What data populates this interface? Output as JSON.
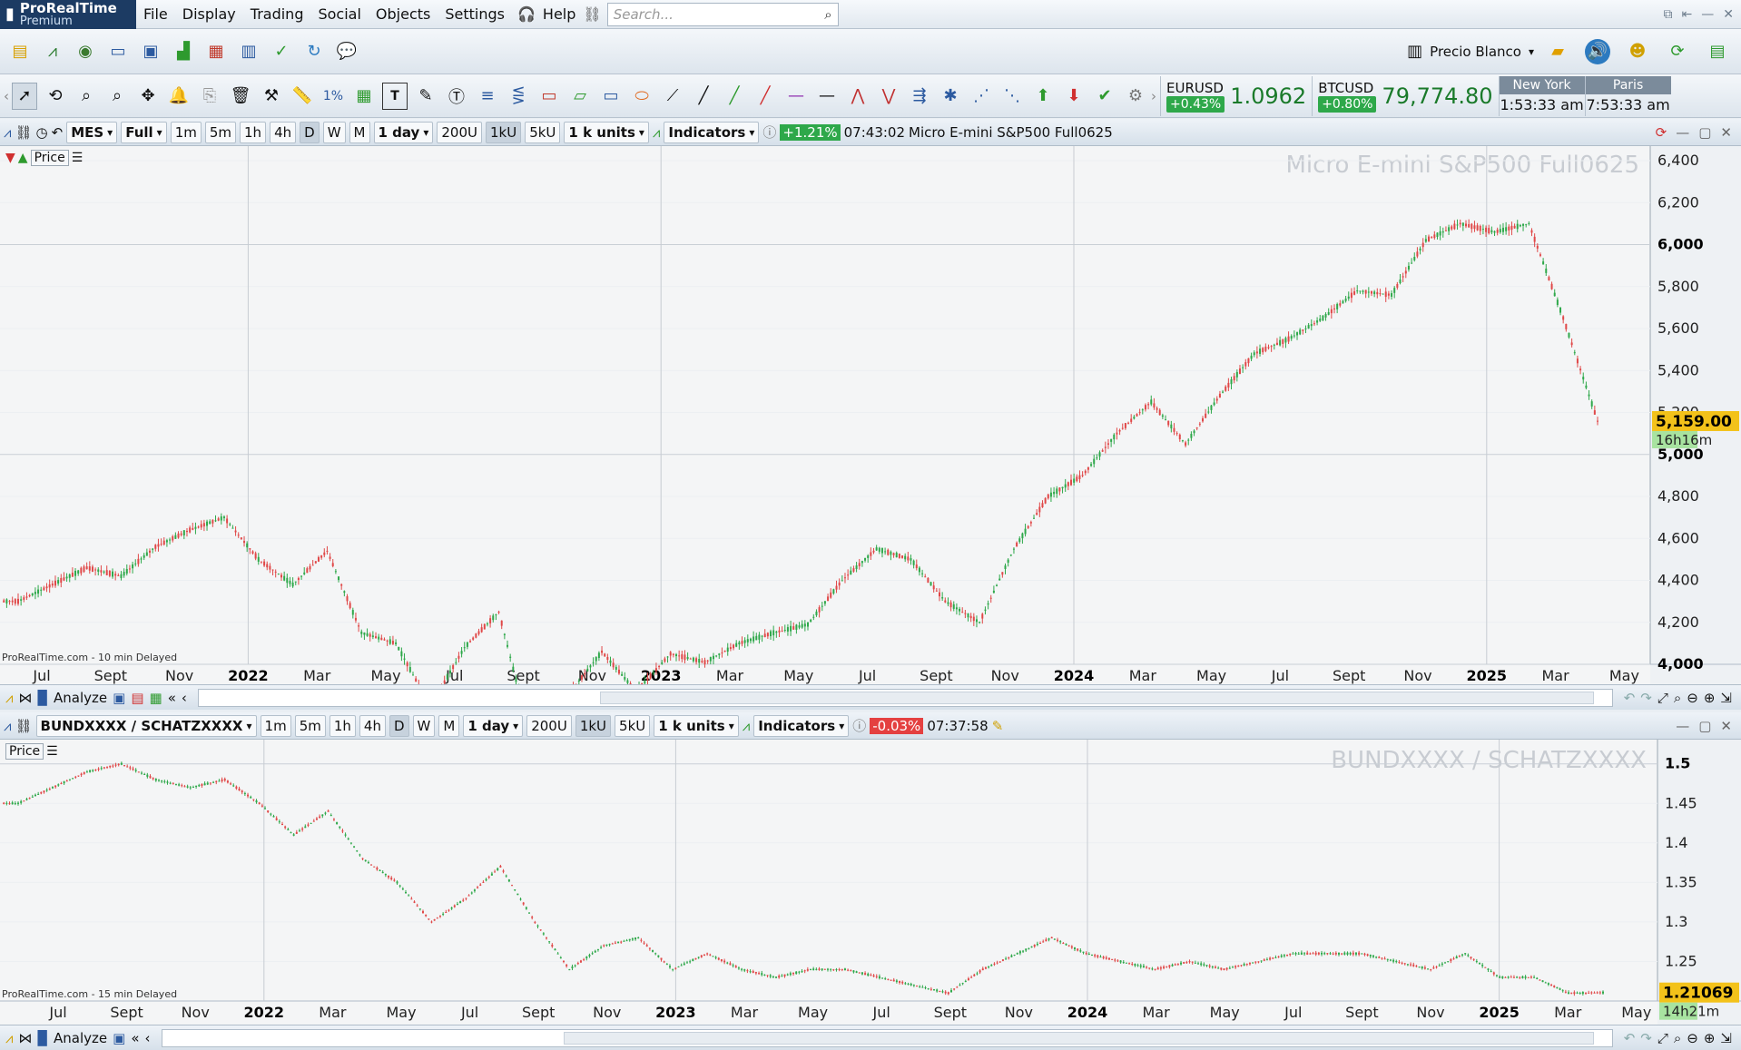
{
  "app": {
    "name": "ProRealTime",
    "edition": "Premium"
  },
  "menu": [
    "File",
    "Display",
    "Trading",
    "Social",
    "Objects",
    "Settings",
    "Help"
  ],
  "search": {
    "placeholder": "Search..."
  },
  "account": {
    "label": "Precio Blanco"
  },
  "quotes": [
    {
      "symbol": "EURUSD",
      "change": "+0.43%",
      "price": "1.0962"
    },
    {
      "symbol": "BTCUSD",
      "change": "+0.80%",
      "price": "79,774.80"
    }
  ],
  "clocks": [
    {
      "city": "New York",
      "time": "1:53:33 am"
    },
    {
      "city": "Paris",
      "time": "7:53:33 am"
    }
  ],
  "colors": {
    "up": "#2ea84a",
    "down": "#e04848",
    "header": "#1c3b63",
    "price_tag": "#f3c21a"
  },
  "chart1": {
    "symbol": "MES",
    "mode": "Full",
    "timeframes": [
      "1m",
      "5m",
      "1h",
      "4h",
      "D",
      "W",
      "M"
    ],
    "period": "1 day",
    "units_buttons": [
      "200U",
      "1kU",
      "5kU"
    ],
    "units": "1 k units",
    "indicators": "Indicators",
    "change": "+1.21%",
    "time": "07:43:02",
    "title": "Micro E-mini S&P500 Full0625",
    "watermark": "Micro E-mini S&P500 Full0625",
    "price_label": "Price",
    "last_price": "5,159.00",
    "countdown": "16h16m",
    "delay_note": "ProRealTime.com - 10 min Delayed"
  },
  "chart2": {
    "symbol": "BUNDXXXX / SCHATZXXXX",
    "timeframes": [
      "1m",
      "5m",
      "1h",
      "4h",
      "D",
      "W",
      "M"
    ],
    "period": "1 day",
    "units_buttons": [
      "200U",
      "1kU",
      "5kU"
    ],
    "units": "1 k units",
    "indicators": "Indicators",
    "change": "-0.03%",
    "time": "07:37:58",
    "watermark": "BUNDXXXX / SCHATZXXXX",
    "price_label": "Price",
    "last_price": "1.21069",
    "countdown": "14h21m",
    "delay_note": "ProRealTime.com - 15 min Delayed"
  },
  "analyze_label": "Analyze",
  "chart_data": [
    {
      "type": "candlestick",
      "title": "Micro E-mini S&P500 Full0625",
      "y_ticks": [
        "4,000",
        "4,200",
        "4,400",
        "4,600",
        "4,800",
        "5,000",
        "5,200",
        "5,400",
        "5,600",
        "5,800",
        "6,000",
        "6,200",
        "6,400"
      ],
      "ylim": [
        4000,
        6400
      ],
      "x_ticks": [
        "Jul",
        "Sept",
        "Nov",
        "2022",
        "Mar",
        "May",
        "Jul",
        "Sept",
        "Nov",
        "2023",
        "Mar",
        "May",
        "Jul",
        "Sept",
        "Nov",
        "2024",
        "Mar",
        "May",
        "Jul",
        "Sept",
        "Nov",
        "2025",
        "Mar",
        "May"
      ],
      "x": [
        "2021-06",
        "2021-07",
        "2021-08",
        "2021-09",
        "2021-10",
        "2021-11",
        "2021-12",
        "2022-01",
        "2022-02",
        "2022-03",
        "2022-04",
        "2022-05",
        "2022-06",
        "2022-07",
        "2022-08",
        "2022-09",
        "2022-10",
        "2022-11",
        "2022-12",
        "2023-01",
        "2023-02",
        "2023-03",
        "2023-04",
        "2023-05",
        "2023-06",
        "2023-07",
        "2023-08",
        "2023-09",
        "2023-10",
        "2023-11",
        "2023-12",
        "2024-01",
        "2024-02",
        "2024-03",
        "2024-04",
        "2024-05",
        "2024-06",
        "2024-07",
        "2024-08",
        "2024-09",
        "2024-10",
        "2024-11",
        "2024-12",
        "2025-01",
        "2025-02",
        "2025-03",
        "2025-04"
      ],
      "close": [
        4300,
        4380,
        4460,
        4420,
        4560,
        4640,
        4700,
        4500,
        4380,
        4540,
        4150,
        4100,
        3800,
        4080,
        4250,
        3600,
        3850,
        4060,
        3870,
        4050,
        4010,
        4100,
        4150,
        4190,
        4400,
        4550,
        4500,
        4300,
        4200,
        4550,
        4800,
        4900,
        5100,
        5250,
        5050,
        5280,
        5480,
        5550,
        5650,
        5780,
        5760,
        6020,
        6100,
        6060,
        6100,
        5650,
        5159
      ],
      "last": 5159.0
    },
    {
      "type": "candlestick",
      "title": "BUNDXXXX / SCHATZXXXX",
      "y_ticks": [
        "1.25",
        "1.3",
        "1.35",
        "1.4",
        "1.45",
        "1.5"
      ],
      "ylim": [
        1.2,
        1.51
      ],
      "x_ticks": [
        "Jul",
        "Sept",
        "Nov",
        "2022",
        "Mar",
        "May",
        "Jul",
        "Sept",
        "Nov",
        "2023",
        "Mar",
        "May",
        "Jul",
        "Sept",
        "Nov",
        "2024",
        "Mar",
        "May",
        "Jul",
        "Sept",
        "Nov",
        "2025",
        "Mar",
        "May"
      ],
      "x": [
        "2021-06",
        "2021-07",
        "2021-08",
        "2021-09",
        "2021-10",
        "2021-11",
        "2021-12",
        "2022-01",
        "2022-02",
        "2022-03",
        "2022-04",
        "2022-05",
        "2022-06",
        "2022-07",
        "2022-08",
        "2022-09",
        "2022-10",
        "2022-11",
        "2022-12",
        "2023-01",
        "2023-02",
        "2023-03",
        "2023-04",
        "2023-05",
        "2023-06",
        "2023-07",
        "2023-08",
        "2023-09",
        "2023-10",
        "2023-11",
        "2023-12",
        "2024-01",
        "2024-02",
        "2024-03",
        "2024-04",
        "2024-05",
        "2024-06",
        "2024-07",
        "2024-08",
        "2024-09",
        "2024-10",
        "2024-11",
        "2024-12",
        "2025-01",
        "2025-02",
        "2025-03",
        "2025-04"
      ],
      "close": [
        1.45,
        1.47,
        1.49,
        1.5,
        1.48,
        1.47,
        1.48,
        1.45,
        1.41,
        1.44,
        1.38,
        1.35,
        1.3,
        1.33,
        1.37,
        1.3,
        1.24,
        1.27,
        1.28,
        1.24,
        1.26,
        1.24,
        1.23,
        1.24,
        1.24,
        1.23,
        1.22,
        1.21,
        1.24,
        1.26,
        1.28,
        1.26,
        1.25,
        1.24,
        1.25,
        1.24,
        1.25,
        1.26,
        1.26,
        1.26,
        1.25,
        1.24,
        1.26,
        1.23,
        1.23,
        1.21,
        1.21069
      ],
      "last": 1.21069
    }
  ]
}
